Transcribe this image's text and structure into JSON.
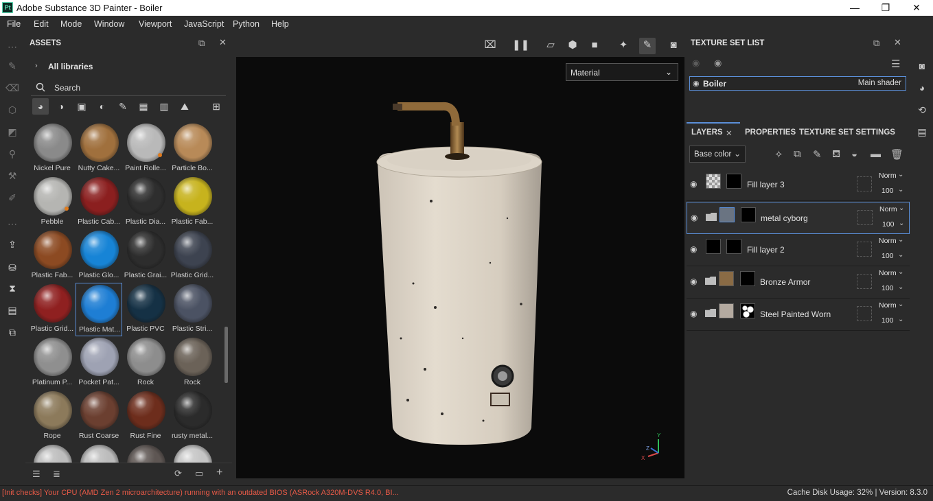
{
  "window": {
    "title": "Adobe Substance 3D Painter - Boiler",
    "app_badge": "Pt"
  },
  "menu": [
    "File",
    "Edit",
    "Mode",
    "Window",
    "Viewport",
    "JavaScript",
    "Python",
    "Help"
  ],
  "assets": {
    "title": "ASSETS",
    "breadcrumb": "All libraries",
    "search_placeholder": "Search",
    "materials": [
      {
        "name": "Nickel Pure",
        "color": "#8a8a8a"
      },
      {
        "name": "Nutty Cake...",
        "color": "#a0703d"
      },
      {
        "name": "Paint Rolle...",
        "color": "#b9b9b9"
      },
      {
        "name": "Particle Bo...",
        "color": "#b88a58"
      },
      {
        "name": "Pebble",
        "color": "#b5b5b2"
      },
      {
        "name": "Plastic Cab...",
        "color": "#8b1f1f"
      },
      {
        "name": "Plastic Dia...",
        "color": "#2e2e2e"
      },
      {
        "name": "Plastic Fab...",
        "color": "#c7b31d"
      },
      {
        "name": "Plastic Fab...",
        "color": "#8c4a22"
      },
      {
        "name": "Plastic Glo...",
        "color": "#1784d6"
      },
      {
        "name": "Plastic Grai...",
        "color": "#2d2d2d"
      },
      {
        "name": "Plastic Grid...",
        "color": "#3d4350"
      },
      {
        "name": "Plastic Grid...",
        "color": "#8f2020"
      },
      {
        "name": "Plastic Mat...",
        "color": "#1e7ed4"
      },
      {
        "name": "Plastic PVC",
        "color": "#153145"
      },
      {
        "name": "Plastic Stri...",
        "color": "#4b5263"
      },
      {
        "name": "Platinum P...",
        "color": "#8f8f8f"
      },
      {
        "name": "Pocket Pat...",
        "color": "#9ea2b3"
      },
      {
        "name": "Rock",
        "color": "#8d8d8d"
      },
      {
        "name": "Rock",
        "color": "#6b6258"
      },
      {
        "name": "Rope",
        "color": "#8c7a5b"
      },
      {
        "name": "Rust Coarse",
        "color": "#6b3f30"
      },
      {
        "name": "Rust Fine",
        "color": "#6d2d1c"
      },
      {
        "name": "rusty metal...",
        "color": "#2b2b2b"
      },
      {
        "name": "",
        "color": "#bdbdbd"
      },
      {
        "name": "",
        "color": "#bcbcbc"
      },
      {
        "name": "",
        "color": "#5e5653"
      },
      {
        "name": "",
        "color": "#c5c5c5"
      }
    ]
  },
  "viewport": {
    "channel_select": "Material",
    "axis_labels": [
      "Y",
      "X",
      "Z"
    ]
  },
  "texture_set_list": {
    "title": "TEXTURE SET LIST",
    "set_name": "Boiler",
    "shader": "Main shader"
  },
  "layers_panel": {
    "tabs": [
      "LAYERS",
      "PROPERTIES",
      "TEXTURE SET SETTINGS"
    ],
    "channel": "Base color",
    "layers": [
      {
        "name": "Fill layer 3",
        "blend": "Norm",
        "opacity": "100",
        "folder": false
      },
      {
        "name": "metal cyborg",
        "blend": "Norm",
        "opacity": "100",
        "folder": true
      },
      {
        "name": "Fill layer 2",
        "blend": "Norm",
        "opacity": "100",
        "folder": false
      },
      {
        "name": "Bronze Armor",
        "blend": "Norm",
        "opacity": "100",
        "folder": true
      },
      {
        "name": "Steel Painted Worn",
        "blend": "Norm",
        "opacity": "100",
        "folder": true
      }
    ]
  },
  "status": {
    "message": "[Init checks] Your CPU (AMD Zen 2 microarchitecture) running with an outdated BIOS (ASRock A320M-DVS R4.0, BI...",
    "right": "Cache Disk Usage:   32% | Version: 8.3.0"
  }
}
